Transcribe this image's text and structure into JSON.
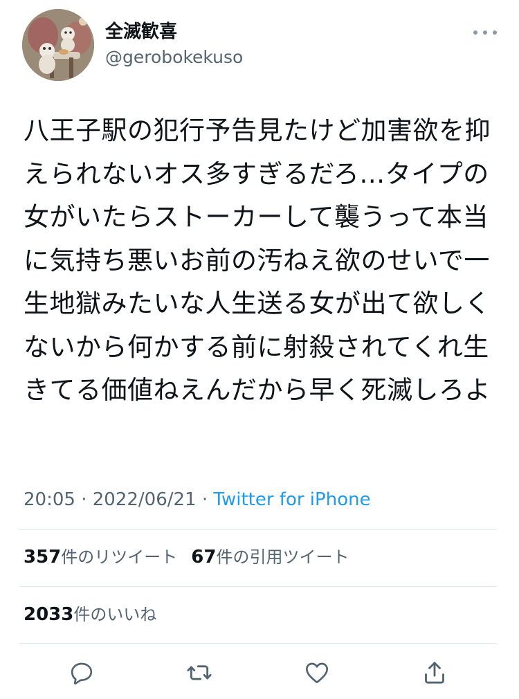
{
  "user": {
    "display_name": "全滅歓喜",
    "handle": "@gerobokekuso",
    "avatar_icon": "avatar-image"
  },
  "more_icon": "more-horizontal-icon",
  "tweet": {
    "text": "八王子駅の犯行予告見たけど加害欲を抑えられないオス多すぎるだろ…タイプの女がいたらストーカーして襲うって本当に気持ち悪いお前の汚ねえ欲のせいで一生地獄みたいな人生送る女が出て欲しくないから何かする前に射殺されてくれ生きてる価値ねえんだから早く死滅しろよ",
    "time": "20:05",
    "separator1": "·",
    "date": "2022/06/21",
    "separator2": "·",
    "source": "Twitter for iPhone"
  },
  "stats": {
    "retweets_count": "357",
    "retweets_label": "件のリツイート",
    "quotes_count": "67",
    "quotes_label": "件の引用ツイート",
    "likes_count": "2033",
    "likes_label": "件のいいね"
  },
  "actions": {
    "reply_icon": "reply-icon",
    "retweet_icon": "retweet-icon",
    "like_icon": "heart-icon",
    "share_icon": "share-icon"
  },
  "colors": {
    "accent": "#1d9bf0",
    "text": "#0f1419",
    "secondary": "#536471",
    "divider": "#e1e6ea",
    "icon": "#536471"
  }
}
